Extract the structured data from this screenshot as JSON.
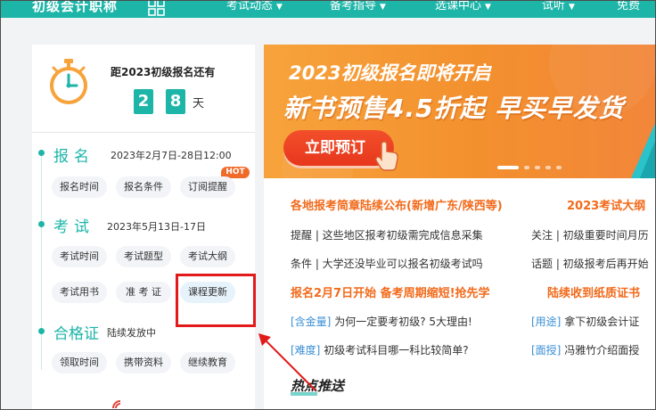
{
  "nav": {
    "logo": "初级会计职称",
    "items": [
      {
        "label": "考试动态",
        "caret": "▼"
      },
      {
        "label": "备考指导",
        "caret": "▼"
      },
      {
        "label": "选课中心",
        "caret": "▼"
      },
      {
        "label": "试听",
        "caret": "▼"
      },
      {
        "label": "免费"
      }
    ]
  },
  "countdown": {
    "title": "距2023初级报名还有",
    "digits": [
      "2",
      "8"
    ],
    "unit": "天"
  },
  "sections": [
    {
      "title": "报名",
      "date": "2023年2月7日-28日12:00",
      "buttons": [
        "报名时间",
        "报名条件",
        "订阅提醒"
      ],
      "badge": "HOT"
    },
    {
      "title": "考试",
      "date": "2023年5月13日-17日",
      "buttons": [
        "考试时间",
        "考试题型",
        "考试大纲",
        "考试用书",
        "准 考 证",
        "课程更新"
      ]
    },
    {
      "title": "合格证",
      "date": "陆续发放中",
      "buttons": [
        "领取时间",
        "携带资料",
        "继续教育"
      ]
    }
  ],
  "banner": {
    "subtitle": "2023初级报名即将开启",
    "title": "新书预售4.5折起 早买早发货",
    "button": "立即预订"
  },
  "news": {
    "headlines": [
      "各地报考简章陆续公布(新增广东/陕西等)",
      "2023考试大纲",
      "报名2月7日开始 备考周期缩短!抢先学",
      "陆续收到纸质证书"
    ],
    "rows": [
      "提醒 | 这些地区报考初级需完成信息采集",
      "关注 | 初级重要时间月历",
      "条件 | 大学还没毕业可以报名初级考试吗",
      "话题 | 初级报考后再开始"
    ],
    "tagged": [
      {
        "tag": "[含金量]",
        "text": "为何一定要考初级? 5大理由!"
      },
      {
        "tag": "[用途]",
        "text": "拿下初级会计证"
      },
      {
        "tag": "[难度]",
        "text": "初级考试科目哪一科比较简单?"
      },
      {
        "tag": "[面授]",
        "text": "冯雅竹介绍面授"
      }
    ],
    "hot": "热点推送"
  },
  "colors": {
    "accent": "#1cb5a8",
    "orange": "#f26a1b",
    "highlight": "#e21a1a",
    "tag": "#3a8fd6"
  }
}
